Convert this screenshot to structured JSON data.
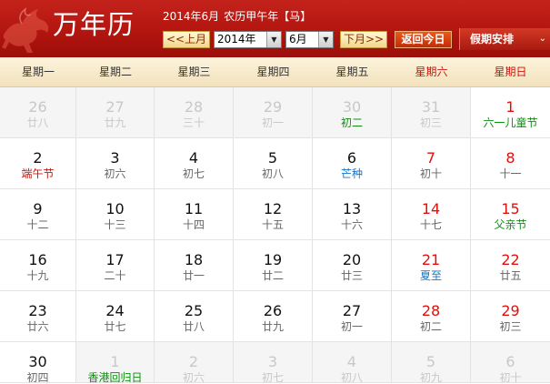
{
  "header": {
    "logo": "万年历",
    "date_text": "2014年6月",
    "lunar_text": "农历甲午年【马】",
    "prev_month_label": "<<上月",
    "year_value": "2014年",
    "month_value": "6月",
    "next_month_label": "下月>>",
    "today_label": "返回今日",
    "holiday_label": "假期安排",
    "dropdown_glyph": "▼",
    "menu_glyph": "⌄"
  },
  "colors": {
    "header_red": "#b3150f",
    "weekend_red": "#c8150f",
    "festival_green": "#0b8f0b",
    "solar_term_blue": "#1576c9",
    "other_month_gray": "#c8c8c8"
  },
  "weekdays": [
    {
      "label": "星期一",
      "weekend": false
    },
    {
      "label": "星期二",
      "weekend": false
    },
    {
      "label": "星期三",
      "weekend": false
    },
    {
      "label": "星期四",
      "weekend": false
    },
    {
      "label": "星期五",
      "weekend": false
    },
    {
      "label": "星期六",
      "weekend": true
    },
    {
      "label": "星期日",
      "weekend": true
    }
  ],
  "weeks": [
    [
      {
        "day": "26",
        "lunar": "廿八",
        "other": true
      },
      {
        "day": "27",
        "lunar": "廿九",
        "other": true
      },
      {
        "day": "28",
        "lunar": "三十",
        "other": true
      },
      {
        "day": "29",
        "lunar": "初一",
        "other": true
      },
      {
        "day": "30",
        "lunar": "初二",
        "other": true,
        "lunar_style": "green"
      },
      {
        "day": "31",
        "lunar": "初三",
        "other": true
      },
      {
        "day": "1",
        "lunar": "六一儿童节",
        "red": true,
        "lunar_style": "green"
      }
    ],
    [
      {
        "day": "2",
        "lunar": "端午节",
        "lunar_style": "red"
      },
      {
        "day": "3",
        "lunar": "初六"
      },
      {
        "day": "4",
        "lunar": "初七"
      },
      {
        "day": "5",
        "lunar": "初八"
      },
      {
        "day": "6",
        "lunar": "芒种",
        "lunar_style": "blue"
      },
      {
        "day": "7",
        "lunar": "初十",
        "red": true
      },
      {
        "day": "8",
        "lunar": "十一",
        "red": true
      }
    ],
    [
      {
        "day": "9",
        "lunar": "十二"
      },
      {
        "day": "10",
        "lunar": "十三"
      },
      {
        "day": "11",
        "lunar": "十四"
      },
      {
        "day": "12",
        "lunar": "十五"
      },
      {
        "day": "13",
        "lunar": "十六"
      },
      {
        "day": "14",
        "lunar": "十七",
        "red": true
      },
      {
        "day": "15",
        "lunar": "父亲节",
        "red": true,
        "lunar_style": "green"
      }
    ],
    [
      {
        "day": "16",
        "lunar": "十九"
      },
      {
        "day": "17",
        "lunar": "二十"
      },
      {
        "day": "18",
        "lunar": "廿一"
      },
      {
        "day": "19",
        "lunar": "廿二"
      },
      {
        "day": "20",
        "lunar": "廿三"
      },
      {
        "day": "21",
        "lunar": "夏至",
        "red": true,
        "lunar_style": "blue"
      },
      {
        "day": "22",
        "lunar": "廿五",
        "red": true
      }
    ],
    [
      {
        "day": "23",
        "lunar": "廿六"
      },
      {
        "day": "24",
        "lunar": "廿七"
      },
      {
        "day": "25",
        "lunar": "廿八"
      },
      {
        "day": "26",
        "lunar": "廿九"
      },
      {
        "day": "27",
        "lunar": "初一"
      },
      {
        "day": "28",
        "lunar": "初二",
        "red": true
      },
      {
        "day": "29",
        "lunar": "初三",
        "red": true
      }
    ],
    [
      {
        "day": "30",
        "lunar": "初四"
      },
      {
        "day": "1",
        "lunar": "香港回归日",
        "other": true,
        "lunar_style": "green"
      },
      {
        "day": "2",
        "lunar": "初六",
        "other": true
      },
      {
        "day": "3",
        "lunar": "初七",
        "other": true
      },
      {
        "day": "4",
        "lunar": "初八",
        "other": true
      },
      {
        "day": "5",
        "lunar": "初九",
        "other": true
      },
      {
        "day": "6",
        "lunar": "初十",
        "other": true
      }
    ]
  ]
}
